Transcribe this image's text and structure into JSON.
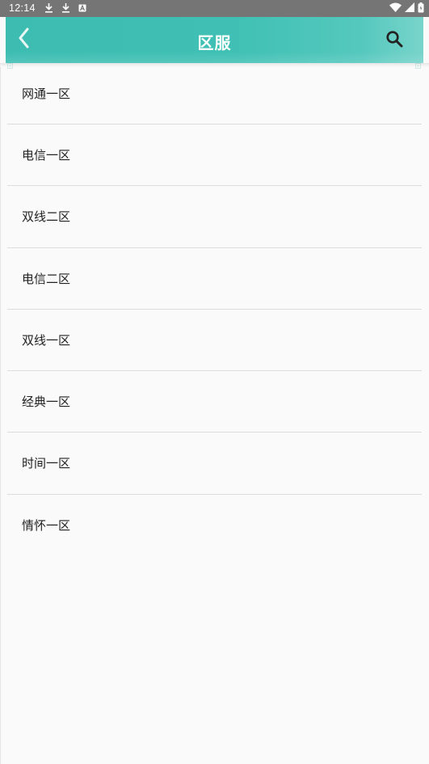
{
  "status_bar": {
    "time": "12:14",
    "left_icons": [
      "download-icon",
      "download-icon",
      "keyboard-icon"
    ],
    "right_icons": [
      "wifi-icon",
      "signal-icon",
      "battery-icon"
    ]
  },
  "app_bar": {
    "title": "区服",
    "back_icon": "chevron-left-icon",
    "search_icon": "search-icon",
    "accent_color": "#3dbdb2"
  },
  "servers": [
    {
      "label": "网通一区"
    },
    {
      "label": "电信一区"
    },
    {
      "label": "双线二区"
    },
    {
      "label": "电信二区"
    },
    {
      "label": "双线一区"
    },
    {
      "label": "经典一区"
    },
    {
      "label": "时间一区"
    },
    {
      "label": "情怀一区"
    }
  ]
}
